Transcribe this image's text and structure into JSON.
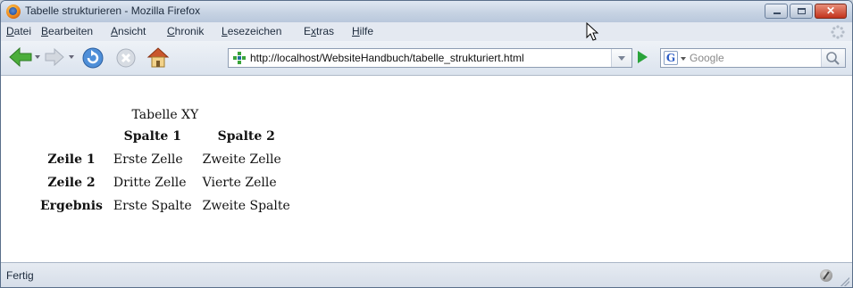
{
  "window": {
    "title": "Tabelle strukturieren - Mozilla Firefox"
  },
  "menu": {
    "items": [
      {
        "acc": "D",
        "rest": "atei"
      },
      {
        "acc": "B",
        "rest": "earbeiten"
      },
      {
        "acc": "A",
        "rest": "nsicht"
      },
      {
        "acc": "C",
        "rest": "hronik"
      },
      {
        "acc": "L",
        "rest": "esezeichen"
      },
      {
        "pre": "E",
        "acc": "x",
        "rest": "tras"
      },
      {
        "acc": "H",
        "rest": "ilfe"
      }
    ]
  },
  "navigation": {
    "url": "http://localhost/WebsiteHandbuch/tabelle_strukturiert.html",
    "search_placeholder": "Google",
    "icons": [
      "back-arrow-icon",
      "forward-arrow-icon",
      "reload-icon",
      "stop-icon",
      "home-icon",
      "go-icon",
      "google-icon",
      "search-magnifier-icon"
    ]
  },
  "table": {
    "caption": "Tabelle XY",
    "columns": [
      "Spalte 1",
      "Spalte 2"
    ],
    "rows": [
      {
        "header": "Zeile 1",
        "cells": [
          "Erste Zelle",
          "Zweite Zelle"
        ]
      },
      {
        "header": "Zeile 2",
        "cells": [
          "Dritte Zelle",
          "Vierte Zelle"
        ]
      }
    ],
    "footer": {
      "header": "Ergebnis",
      "cells": [
        "Erste Spalte",
        "Zweite Spalte"
      ]
    }
  },
  "status": {
    "text": "Fertig"
  },
  "colors": {
    "title_bar": "#c7d3e3",
    "close_button": "#c2331c",
    "go_button": "#29a33a"
  }
}
